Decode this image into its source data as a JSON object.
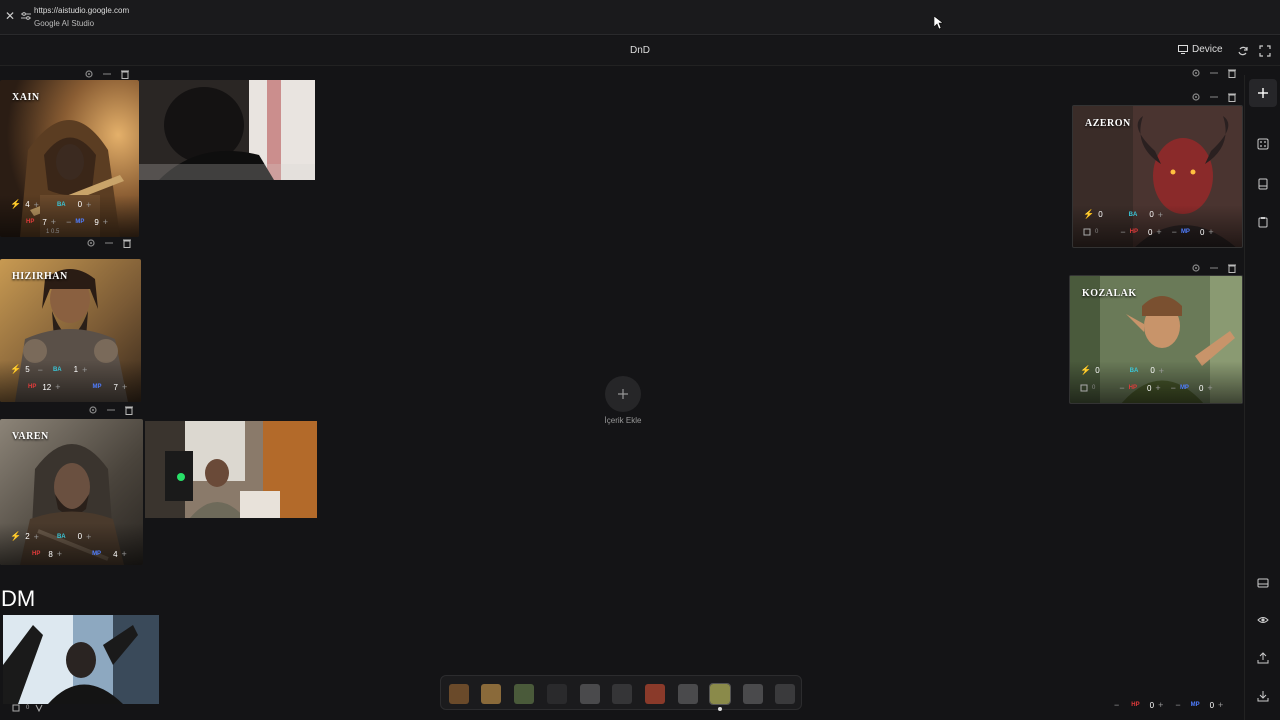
{
  "browser": {
    "url": "https://aistudio.google.com",
    "site_name": "Google AI Studio"
  },
  "header": {
    "title": "DnD",
    "device_label": "Device"
  },
  "characters": [
    {
      "name": "XAIN",
      "energy": "4",
      "ba": "0",
      "hp": "7",
      "mp": "9",
      "sub": "1 0.5"
    },
    {
      "name": "HIZIRHAN",
      "energy": "5",
      "ba": "1",
      "hp": "12",
      "mp": "7"
    },
    {
      "name": "VAREN",
      "energy": "2",
      "ba": "0",
      "hp": "8",
      "mp": "4"
    },
    {
      "name": "AZERON",
      "energy": "0",
      "ba": "0",
      "hp": "0",
      "mp": "0",
      "shield": "0"
    },
    {
      "name": "KOZALAK",
      "energy": "0",
      "ba": "0",
      "hp": "0",
      "mp": "0",
      "shield": "0"
    }
  ],
  "labels": {
    "ba": "BA",
    "hp": "HP",
    "mp": "MP",
    "dm": "DM",
    "add_content": "İçerik Ekle"
  },
  "bottom_stats": {
    "hp": "0",
    "mp": "0"
  },
  "dm_bottom": {
    "shield": "0"
  },
  "colors": {
    "background": "#141416",
    "ba": "#3ac6d8",
    "hp": "#e23b3b",
    "mp": "#4f7dff",
    "energy": "#d4b800"
  }
}
